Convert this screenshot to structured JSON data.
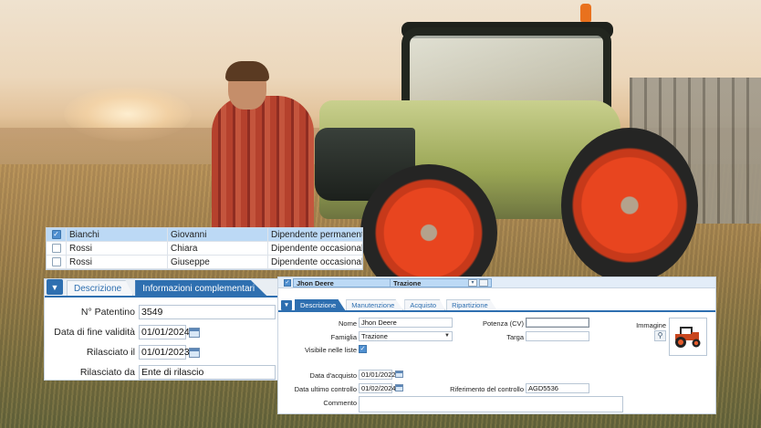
{
  "grid": {
    "rows": [
      {
        "surname": "Bianchi",
        "name": "Giovanni",
        "type": "Dipendente permanente",
        "checked": true
      },
      {
        "surname": "Rossi",
        "name": "Chiara",
        "type": "Dipendente occasionale",
        "checked": false
      },
      {
        "surname": "Rossi",
        "name": "Giuseppe",
        "type": "Dipendente occasionale",
        "checked": false
      }
    ]
  },
  "license": {
    "toggle_icon": "chevron-down-icon",
    "tabs": [
      "Descrizione",
      "Informazioni complementari"
    ],
    "active_tab": 1,
    "fields": {
      "license_no": {
        "label": "N° Patentino",
        "value": "3549"
      },
      "expiry": {
        "label": "Data di fine validità",
        "value": "01/01/2024"
      },
      "issued_on": {
        "label": "Rilasciato il",
        "value": "01/01/2023"
      },
      "issued_by": {
        "label": "Rilasciato da",
        "value": "Ente di rilascio"
      }
    }
  },
  "vehicle": {
    "header": {
      "name": "Jhon Deere",
      "family": "Trazione"
    },
    "tabs": [
      "Descrizione",
      "Manutenzione",
      "Acquisto",
      "Ripartizione"
    ],
    "active_tab": 0,
    "fields": {
      "nome": {
        "label": "Nome",
        "value": "Jhon Deere"
      },
      "famiglia": {
        "label": "Famiglia",
        "value": "Trazione"
      },
      "visibile": {
        "label": "Visibile nelle liste",
        "checked": true
      },
      "potenza": {
        "label": "Potenza (CV)",
        "value": ""
      },
      "targa": {
        "label": "Targa",
        "value": ""
      },
      "immagine": {
        "label": "Immagine"
      },
      "data_acquisto": {
        "label": "Data d'acquisto",
        "value": "01/01/2022"
      },
      "data_controllo": {
        "label": "Data ultimo controllo",
        "value": "01/02/2024"
      },
      "riferimento": {
        "label": "Riferimento del controllo",
        "value": "AGD5536"
      },
      "commento": {
        "label": "Commento",
        "value": ""
      }
    }
  },
  "colors": {
    "accent": "#2e6fb0",
    "selection": "#bcd9f5",
    "tractor_wheel": "#e8451f",
    "tractor_green": "#9aa655"
  }
}
